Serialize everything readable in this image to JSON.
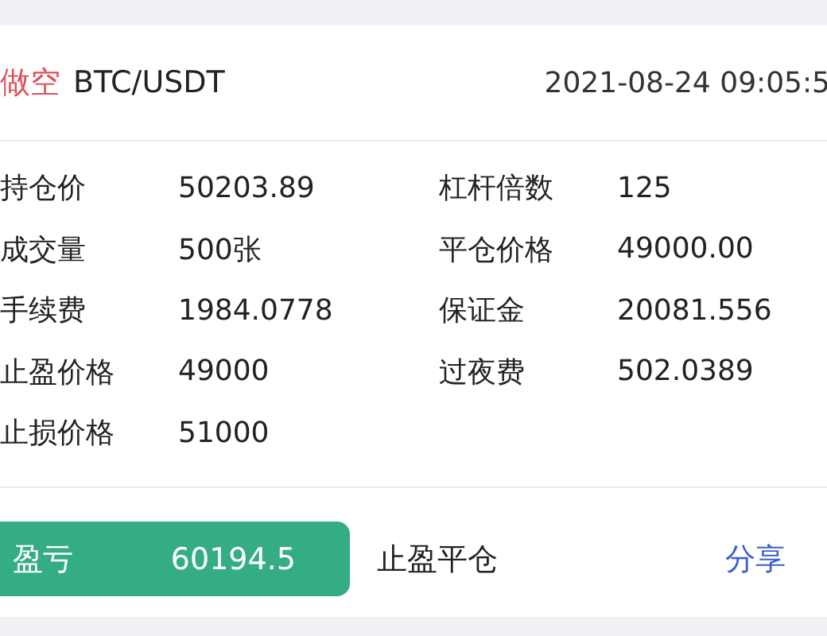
{
  "header": {
    "direction": {
      "label": "做空",
      "kind": "short"
    },
    "pair": "BTC/USDT",
    "time": "2021-08-24 09:05:5"
  },
  "fields": [
    {
      "label": "持仓价",
      "value": "50203.89"
    },
    {
      "label": "杠杆倍数",
      "value": "125"
    },
    {
      "label": "成交量",
      "value": "500张"
    },
    {
      "label": "平仓价格",
      "value": "49000.00"
    },
    {
      "label": "手续费",
      "value": "1984.0778"
    },
    {
      "label": "保证金",
      "value": "20081.556"
    },
    {
      "label": "止盈价格",
      "value": "49000"
    },
    {
      "label": "过夜费",
      "value": "502.0389"
    },
    {
      "label": "止损价格",
      "value": "51000"
    }
  ],
  "footer": {
    "pnl_label": "盈亏",
    "pnl_value": "60194.5",
    "close_type": "止盈平仓",
    "share": "分享"
  }
}
